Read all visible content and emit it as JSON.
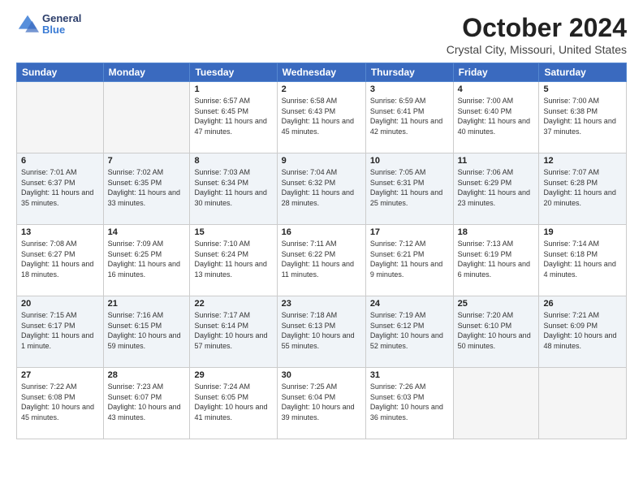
{
  "logo": {
    "general": "General",
    "blue": "Blue"
  },
  "header": {
    "title": "October 2024",
    "subtitle": "Crystal City, Missouri, United States"
  },
  "weekdays": [
    "Sunday",
    "Monday",
    "Tuesday",
    "Wednesday",
    "Thursday",
    "Friday",
    "Saturday"
  ],
  "weeks": [
    [
      {
        "day": "",
        "sunrise": "",
        "sunset": "",
        "daylight": ""
      },
      {
        "day": "",
        "sunrise": "",
        "sunset": "",
        "daylight": ""
      },
      {
        "day": "1",
        "sunrise": "Sunrise: 6:57 AM",
        "sunset": "Sunset: 6:45 PM",
        "daylight": "Daylight: 11 hours and 47 minutes."
      },
      {
        "day": "2",
        "sunrise": "Sunrise: 6:58 AM",
        "sunset": "Sunset: 6:43 PM",
        "daylight": "Daylight: 11 hours and 45 minutes."
      },
      {
        "day": "3",
        "sunrise": "Sunrise: 6:59 AM",
        "sunset": "Sunset: 6:41 PM",
        "daylight": "Daylight: 11 hours and 42 minutes."
      },
      {
        "day": "4",
        "sunrise": "Sunrise: 7:00 AM",
        "sunset": "Sunset: 6:40 PM",
        "daylight": "Daylight: 11 hours and 40 minutes."
      },
      {
        "day": "5",
        "sunrise": "Sunrise: 7:00 AM",
        "sunset": "Sunset: 6:38 PM",
        "daylight": "Daylight: 11 hours and 37 minutes."
      }
    ],
    [
      {
        "day": "6",
        "sunrise": "Sunrise: 7:01 AM",
        "sunset": "Sunset: 6:37 PM",
        "daylight": "Daylight: 11 hours and 35 minutes."
      },
      {
        "day": "7",
        "sunrise": "Sunrise: 7:02 AM",
        "sunset": "Sunset: 6:35 PM",
        "daylight": "Daylight: 11 hours and 33 minutes."
      },
      {
        "day": "8",
        "sunrise": "Sunrise: 7:03 AM",
        "sunset": "Sunset: 6:34 PM",
        "daylight": "Daylight: 11 hours and 30 minutes."
      },
      {
        "day": "9",
        "sunrise": "Sunrise: 7:04 AM",
        "sunset": "Sunset: 6:32 PM",
        "daylight": "Daylight: 11 hours and 28 minutes."
      },
      {
        "day": "10",
        "sunrise": "Sunrise: 7:05 AM",
        "sunset": "Sunset: 6:31 PM",
        "daylight": "Daylight: 11 hours and 25 minutes."
      },
      {
        "day": "11",
        "sunrise": "Sunrise: 7:06 AM",
        "sunset": "Sunset: 6:29 PM",
        "daylight": "Daylight: 11 hours and 23 minutes."
      },
      {
        "day": "12",
        "sunrise": "Sunrise: 7:07 AM",
        "sunset": "Sunset: 6:28 PM",
        "daylight": "Daylight: 11 hours and 20 minutes."
      }
    ],
    [
      {
        "day": "13",
        "sunrise": "Sunrise: 7:08 AM",
        "sunset": "Sunset: 6:27 PM",
        "daylight": "Daylight: 11 hours and 18 minutes."
      },
      {
        "day": "14",
        "sunrise": "Sunrise: 7:09 AM",
        "sunset": "Sunset: 6:25 PM",
        "daylight": "Daylight: 11 hours and 16 minutes."
      },
      {
        "day": "15",
        "sunrise": "Sunrise: 7:10 AM",
        "sunset": "Sunset: 6:24 PM",
        "daylight": "Daylight: 11 hours and 13 minutes."
      },
      {
        "day": "16",
        "sunrise": "Sunrise: 7:11 AM",
        "sunset": "Sunset: 6:22 PM",
        "daylight": "Daylight: 11 hours and 11 minutes."
      },
      {
        "day": "17",
        "sunrise": "Sunrise: 7:12 AM",
        "sunset": "Sunset: 6:21 PM",
        "daylight": "Daylight: 11 hours and 9 minutes."
      },
      {
        "day": "18",
        "sunrise": "Sunrise: 7:13 AM",
        "sunset": "Sunset: 6:19 PM",
        "daylight": "Daylight: 11 hours and 6 minutes."
      },
      {
        "day": "19",
        "sunrise": "Sunrise: 7:14 AM",
        "sunset": "Sunset: 6:18 PM",
        "daylight": "Daylight: 11 hours and 4 minutes."
      }
    ],
    [
      {
        "day": "20",
        "sunrise": "Sunrise: 7:15 AM",
        "sunset": "Sunset: 6:17 PM",
        "daylight": "Daylight: 11 hours and 1 minute."
      },
      {
        "day": "21",
        "sunrise": "Sunrise: 7:16 AM",
        "sunset": "Sunset: 6:15 PM",
        "daylight": "Daylight: 10 hours and 59 minutes."
      },
      {
        "day": "22",
        "sunrise": "Sunrise: 7:17 AM",
        "sunset": "Sunset: 6:14 PM",
        "daylight": "Daylight: 10 hours and 57 minutes."
      },
      {
        "day": "23",
        "sunrise": "Sunrise: 7:18 AM",
        "sunset": "Sunset: 6:13 PM",
        "daylight": "Daylight: 10 hours and 55 minutes."
      },
      {
        "day": "24",
        "sunrise": "Sunrise: 7:19 AM",
        "sunset": "Sunset: 6:12 PM",
        "daylight": "Daylight: 10 hours and 52 minutes."
      },
      {
        "day": "25",
        "sunrise": "Sunrise: 7:20 AM",
        "sunset": "Sunset: 6:10 PM",
        "daylight": "Daylight: 10 hours and 50 minutes."
      },
      {
        "day": "26",
        "sunrise": "Sunrise: 7:21 AM",
        "sunset": "Sunset: 6:09 PM",
        "daylight": "Daylight: 10 hours and 48 minutes."
      }
    ],
    [
      {
        "day": "27",
        "sunrise": "Sunrise: 7:22 AM",
        "sunset": "Sunset: 6:08 PM",
        "daylight": "Daylight: 10 hours and 45 minutes."
      },
      {
        "day": "28",
        "sunrise": "Sunrise: 7:23 AM",
        "sunset": "Sunset: 6:07 PM",
        "daylight": "Daylight: 10 hours and 43 minutes."
      },
      {
        "day": "29",
        "sunrise": "Sunrise: 7:24 AM",
        "sunset": "Sunset: 6:05 PM",
        "daylight": "Daylight: 10 hours and 41 minutes."
      },
      {
        "day": "30",
        "sunrise": "Sunrise: 7:25 AM",
        "sunset": "Sunset: 6:04 PM",
        "daylight": "Daylight: 10 hours and 39 minutes."
      },
      {
        "day": "31",
        "sunrise": "Sunrise: 7:26 AM",
        "sunset": "Sunset: 6:03 PM",
        "daylight": "Daylight: 10 hours and 36 minutes."
      },
      {
        "day": "",
        "sunrise": "",
        "sunset": "",
        "daylight": ""
      },
      {
        "day": "",
        "sunrise": "",
        "sunset": "",
        "daylight": ""
      }
    ]
  ]
}
